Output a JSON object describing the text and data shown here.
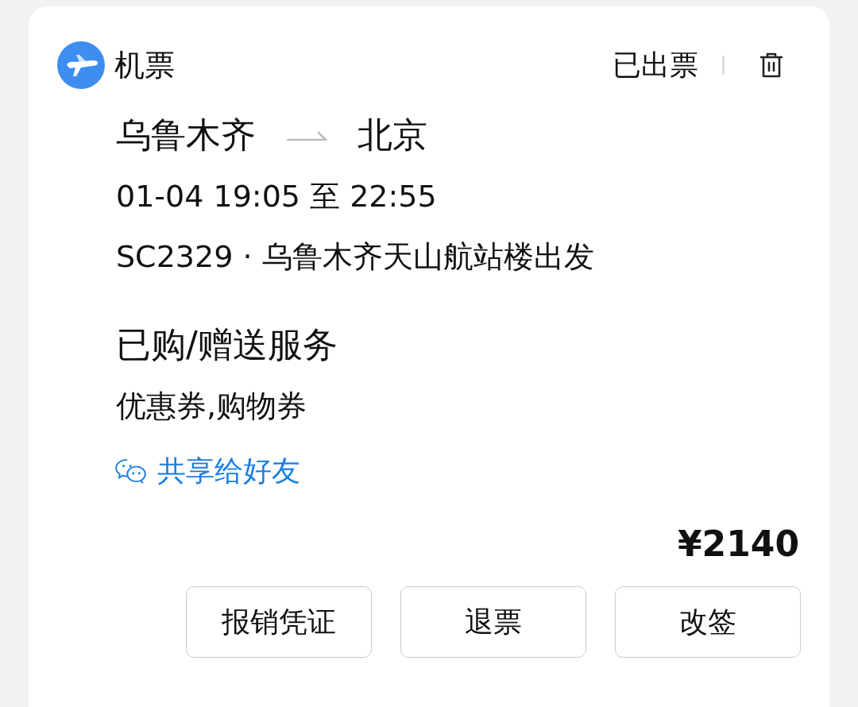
{
  "header": {
    "category": "机票",
    "status": "已出票"
  },
  "route": {
    "from": "乌鲁木齐",
    "to": "北京"
  },
  "time": "01-04 19:05 至 22:55",
  "flight": "SC2329 · 乌鲁木齐天山航站楼出发",
  "services": {
    "title": "已购/赠送服务",
    "items": "优惠券,购物券"
  },
  "share": {
    "label": "共享给好友"
  },
  "price": "¥2140",
  "buttons": [
    "报销凭证",
    "退票",
    "改签"
  ]
}
